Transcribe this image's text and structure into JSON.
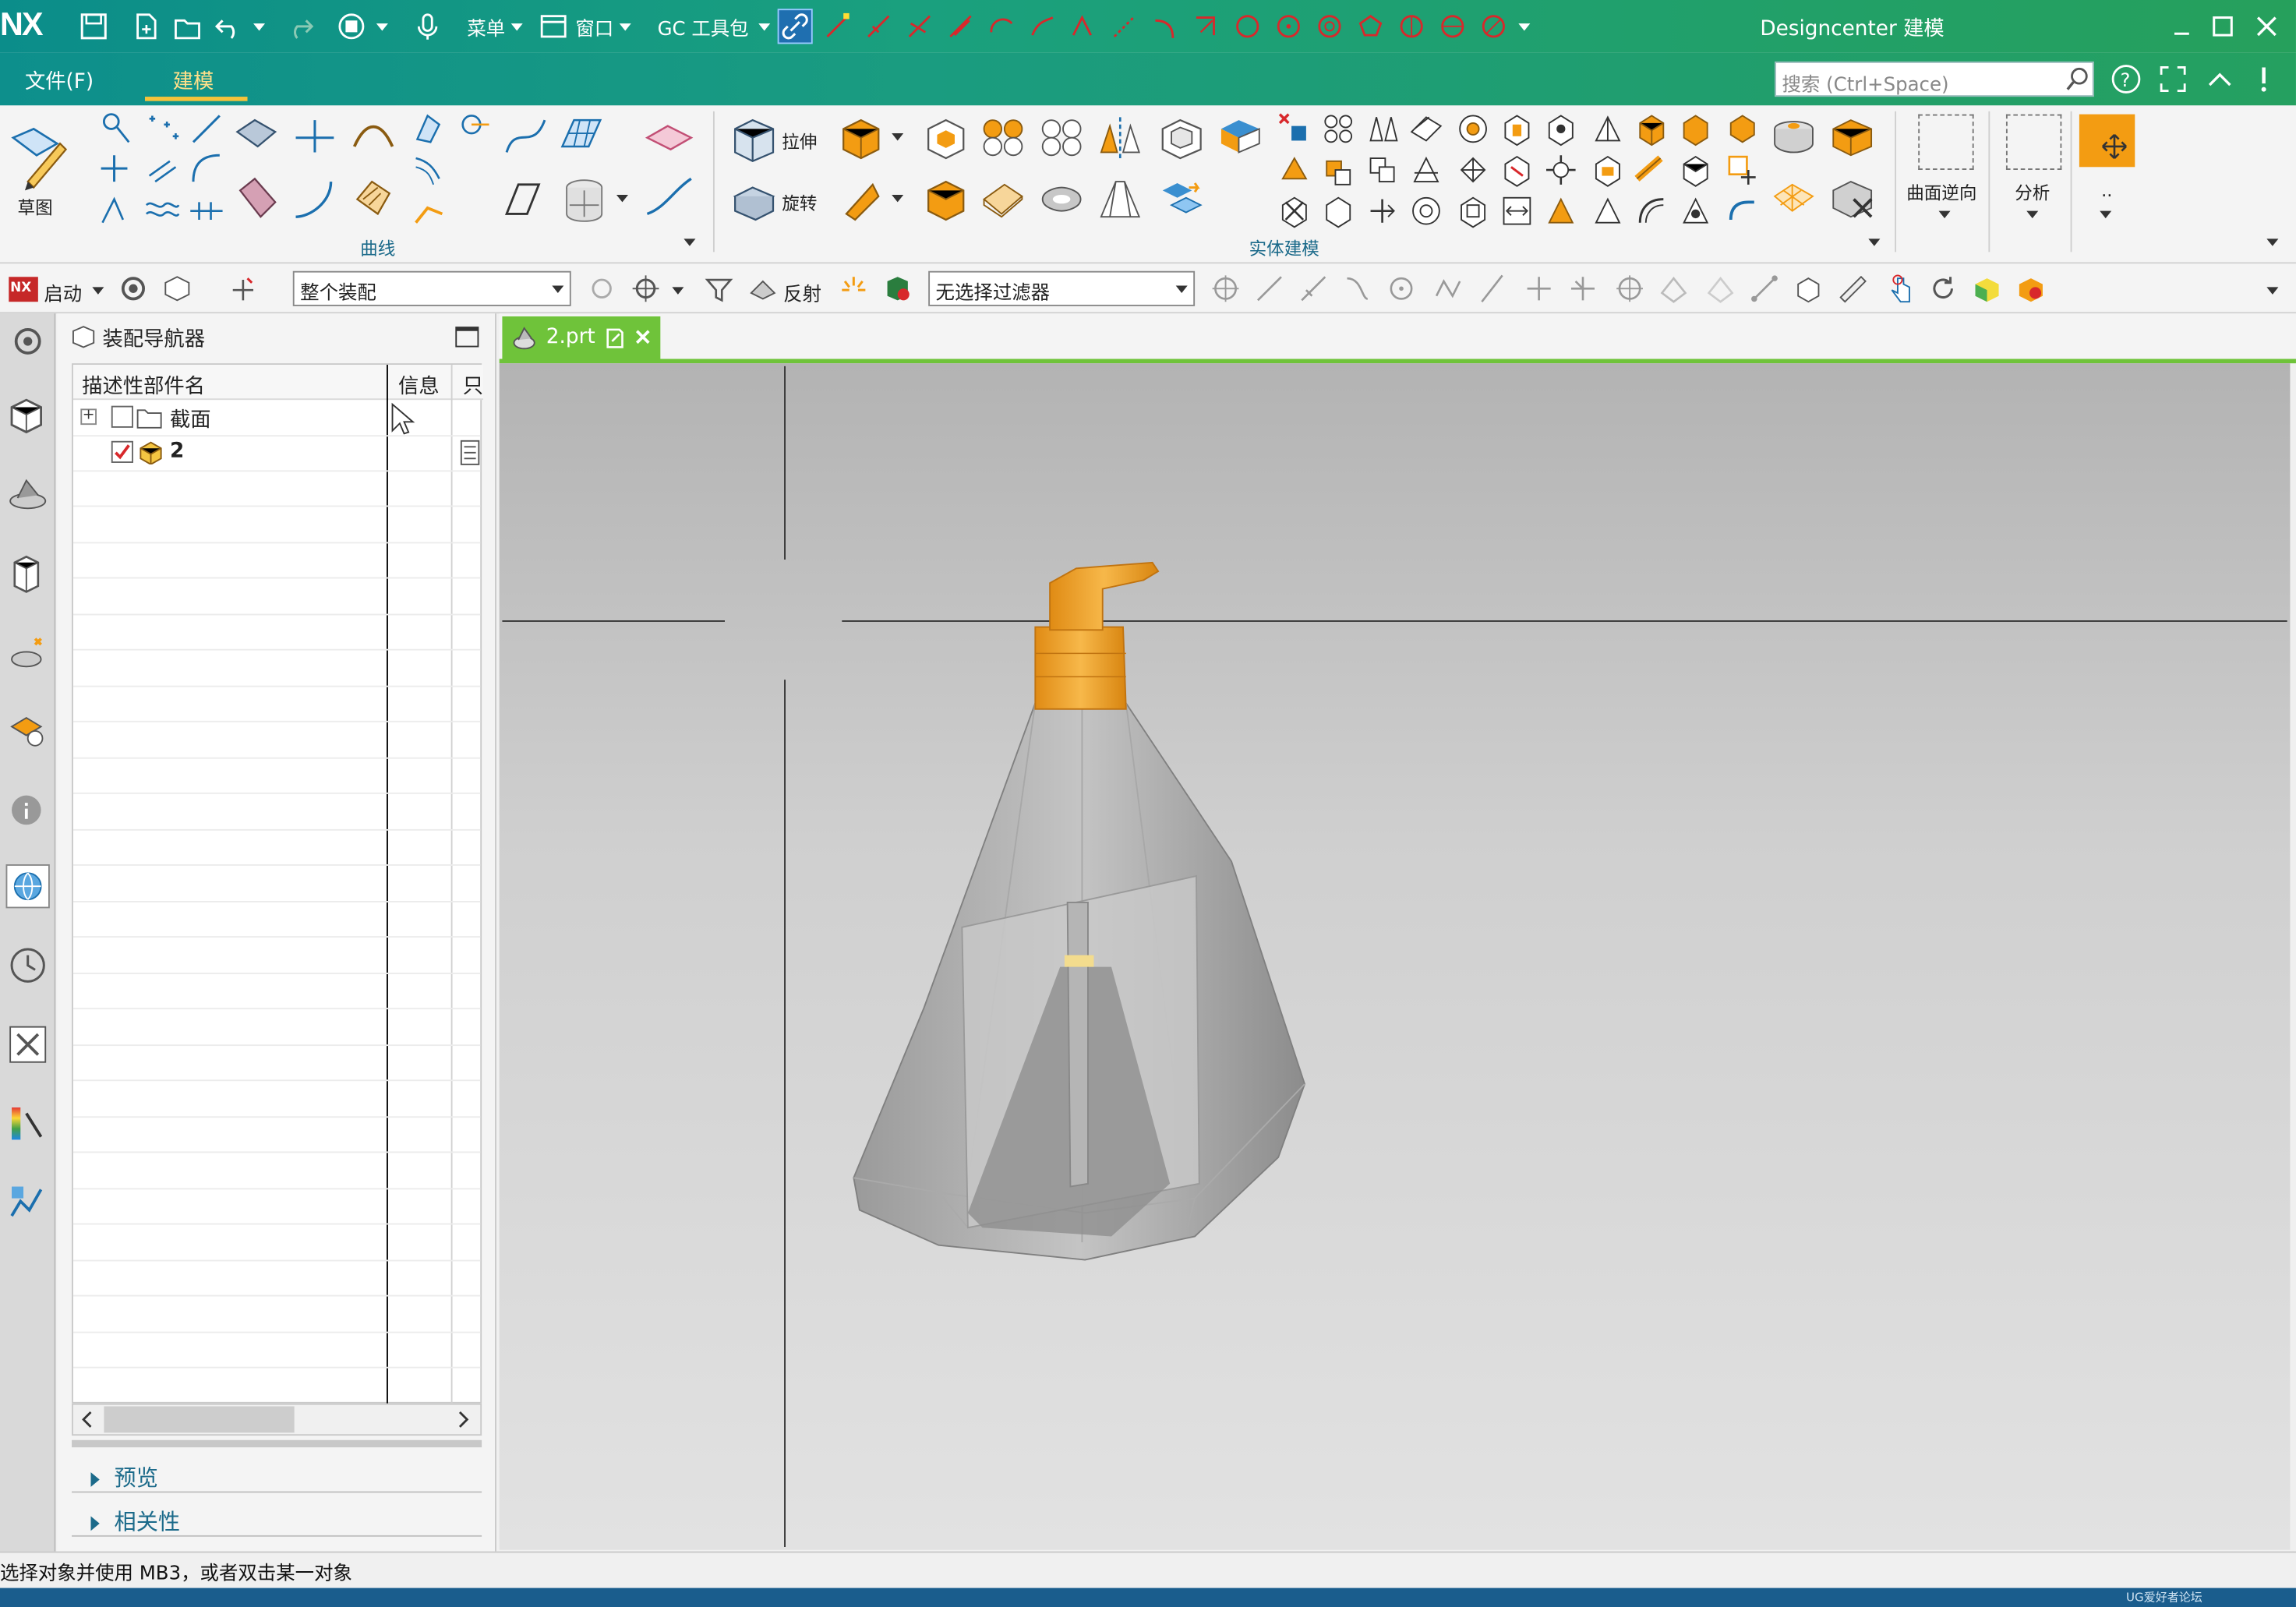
{
  "app": {
    "logo": "NX",
    "window_title": "Designcenter 建模"
  },
  "quick_access": {
    "menu_label": "菜单",
    "window_label": "窗口",
    "gc_toolkit_label": "GC 工具包"
  },
  "menu": {
    "file": "文件(F)",
    "modeling": "建模"
  },
  "search": {
    "placeholder": "搜索 (Ctrl+Space)"
  },
  "ribbon": {
    "sketch_label": "草图",
    "curve_group_label": "曲线",
    "extrude_label": "拉伸",
    "revolve_label": "旋转",
    "solid_group_label": "实体建模",
    "surface_reverse_label": "曲面逆向",
    "analysis_label": "分析",
    "more_label": ".."
  },
  "toolbar2": {
    "start_label": "启动",
    "assembly_scope": "整个装配",
    "reflect_label": "反射",
    "filter": "无选择过滤器"
  },
  "navigator": {
    "title": "装配导航器",
    "columns": [
      "描述性部件名",
      "信息",
      "只"
    ],
    "rows": [
      {
        "name": "截面",
        "checked": false
      },
      {
        "name": "2",
        "checked": true
      }
    ],
    "sections": [
      "预览",
      "相关性"
    ]
  },
  "document_tab": {
    "label": "2.prt"
  },
  "status": {
    "message": "选择对象并使用 MB3，或者双击某一对象"
  },
  "watermark": "UG爱好者论坛 WWW.UGSNX.COM",
  "colors": {
    "title_gradient_start": "#0b8d8a",
    "title_gradient_end": "#26a05c",
    "accent_orange": "#f39c12",
    "tab_green": "#6fc33a",
    "status_blue": "#1a5d8d"
  }
}
